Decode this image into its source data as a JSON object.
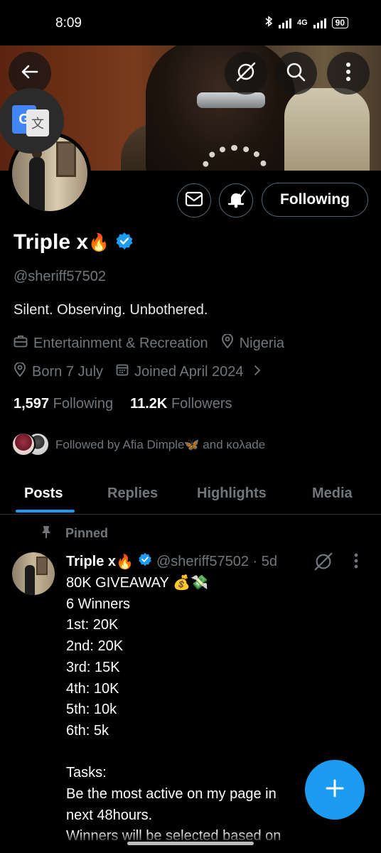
{
  "status_bar": {
    "time": "8:09",
    "network": "4G",
    "battery": "90"
  },
  "header": {
    "back_icon": "back-arrow-icon",
    "grok_icon": "grok-icon",
    "search_icon": "search-icon",
    "more_icon": "more-vertical-icon"
  },
  "translate_bubble": {
    "icon": "google-translate-icon",
    "g_letter": "G",
    "glyph": "文"
  },
  "profile": {
    "display_name": "Triple x",
    "name_emoji": "🔥",
    "verified": true,
    "handle": "@sheriff57502",
    "bio": "Silent. Observing. Unbothered.",
    "category": "Entertainment & Recreation",
    "location": "Nigeria",
    "birthday": "Born 7 July",
    "joined": "Joined April 2024",
    "following_count": "1,597",
    "following_label": "Following",
    "followers_count": "11.2K",
    "followers_label": "Followers",
    "followed_by": "Followed by Afia Dimple🦋 and κoλade"
  },
  "actions": {
    "message_icon": "mail-icon",
    "notification_icon": "bell-subscribed-icon",
    "following_button": "Following"
  },
  "tabs": [
    {
      "label": "Posts",
      "active": true
    },
    {
      "label": "Replies",
      "active": false
    },
    {
      "label": "Highlights",
      "active": false
    },
    {
      "label": "Media",
      "active": false
    }
  ],
  "pinned_post": {
    "pinned_label": "Pinned",
    "author_name": "Triple x",
    "author_emoji": "🔥",
    "handle_time": "@sheriff57502 · 5d",
    "body": "80K GIVEAWAY 💰💸\n6 Winners\n1st: 20K\n2nd: 20K\n3rd: 15K\n4th: 10K\n5th: 10k\n6th: 5k\n\nTasks:\nBe the most active on my page in\nnext 48hours.\nWinners will be selected based on"
  },
  "fab": {
    "icon": "plus-icon"
  },
  "colors": {
    "accent": "#1d9bf0",
    "secondary_text": "#71767b",
    "primary_text": "#e7e9ea",
    "background": "#000000",
    "border": "#2f3336"
  }
}
